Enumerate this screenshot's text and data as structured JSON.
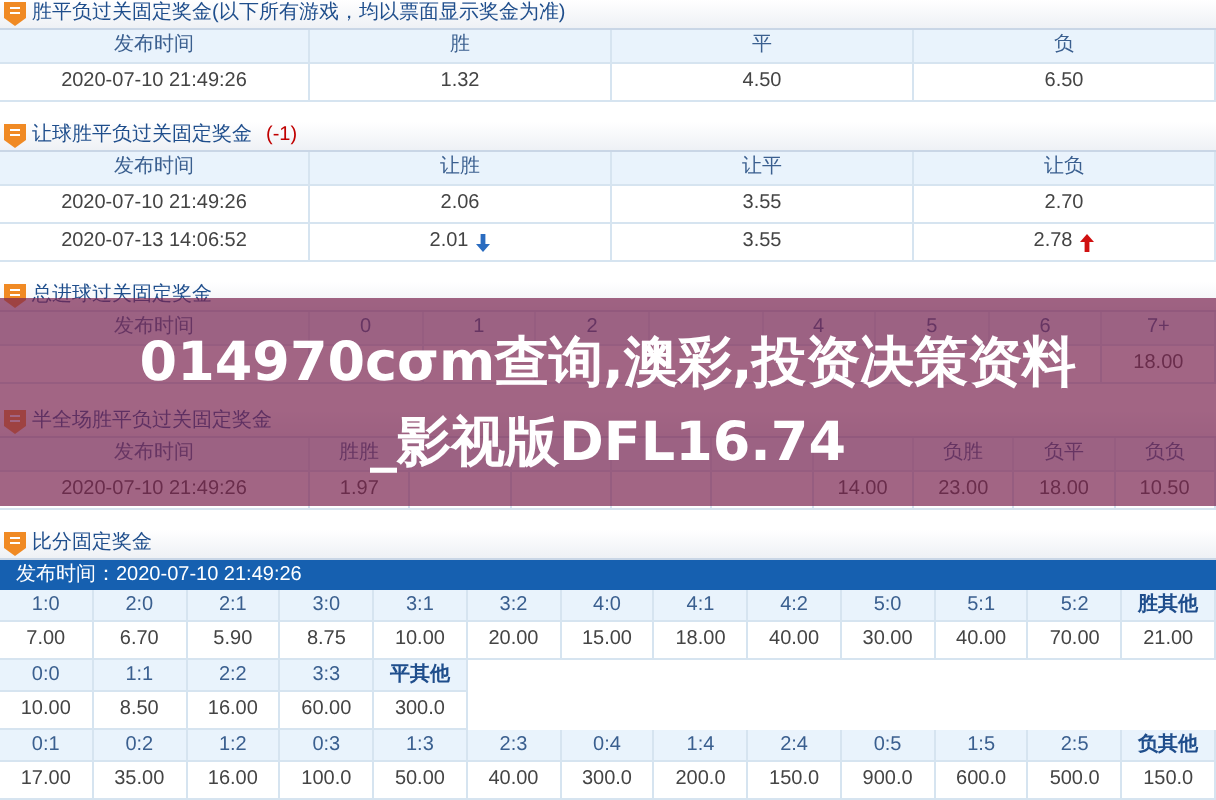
{
  "sections": [
    {
      "kind": "odds",
      "title": "胜平负过关固定奖金(以下所有游戏，均以票面显示奖金为准)",
      "columns": [
        "发布时间",
        "胜",
        "平",
        "负"
      ],
      "rows": [
        {
          "cells": [
            "2020-07-10 21:49:26",
            "1.32",
            "4.50",
            "6.50"
          ]
        }
      ]
    },
    {
      "kind": "odds",
      "title": "让球胜平负过关固定奖金",
      "handicap": "(-1)",
      "columns": [
        "发布时间",
        "让胜",
        "让平",
        "让负"
      ],
      "rows": [
        {
          "cells": [
            "2020-07-10 21:49:26",
            "2.06",
            "3.55",
            "2.70"
          ]
        },
        {
          "cells": [
            "2020-07-13 14:06:52",
            {
              "text": "2.01",
              "up": false
            },
            "3.55",
            {
              "text": "2.78",
              "up": true
            }
          ]
        }
      ]
    },
    {
      "kind": "odds",
      "title": "总进球过关固定奖金",
      "columns": [
        "发布时间",
        "0",
        "1",
        "2",
        null,
        "4",
        "5",
        "6",
        "7+"
      ],
      "rows": [
        {
          "cells": [
            null,
            null,
            null,
            null,
            null,
            null,
            null,
            null,
            "18.00"
          ]
        }
      ]
    },
    {
      "kind": "odds",
      "title": "半全场胜平负过关固定奖金",
      "columns": [
        "发布时间",
        "胜胜",
        null,
        null,
        null,
        null,
        null,
        "负胜",
        "负平",
        "负负"
      ],
      "rows": [
        {
          "cells": [
            "2020-07-10 21:49:26",
            "1.97",
            null,
            null,
            null,
            null,
            "14.00",
            "23.00",
            "18.00",
            "10.50"
          ]
        }
      ]
    },
    {
      "kind": "score",
      "title": "比分固定奖金",
      "published": "发布时间：2020-07-10 21:49:26",
      "groups": [
        {
          "labels": [
            "1:0",
            "2:0",
            "2:1",
            "3:0",
            "3:1",
            "3:2",
            "4:0",
            "4:1",
            "4:2",
            "5:0",
            "5:1",
            "5:2",
            "胜其他"
          ],
          "values": [
            "7.00",
            "6.70",
            "5.90",
            "8.75",
            "10.00",
            "20.00",
            "15.00",
            "18.00",
            "40.00",
            "30.00",
            "40.00",
            "70.00",
            "21.00"
          ]
        },
        {
          "labels": [
            "0:0",
            "1:1",
            "2:2",
            "3:3",
            "平其他"
          ],
          "values": [
            "10.00",
            "8.50",
            "16.00",
            "60.00",
            "300.0"
          ]
        },
        {
          "labels": [
            "0:1",
            "0:2",
            "1:2",
            "0:3",
            "1:3",
            "2:3",
            "0:4",
            "1:4",
            "2:4",
            "0:5",
            "1:5",
            "2:5",
            "负其他"
          ],
          "values": [
            "17.00",
            "35.00",
            "16.00",
            "100.0",
            "50.00",
            "40.00",
            "300.0",
            "200.0",
            "150.0",
            "900.0",
            "600.0",
            "500.0",
            "150.0"
          ]
        }
      ]
    }
  ],
  "banner": {
    "lines": [
      "014970cσm查询,澳彩,投资决策资料",
      "_影视版DFL16.74"
    ]
  }
}
